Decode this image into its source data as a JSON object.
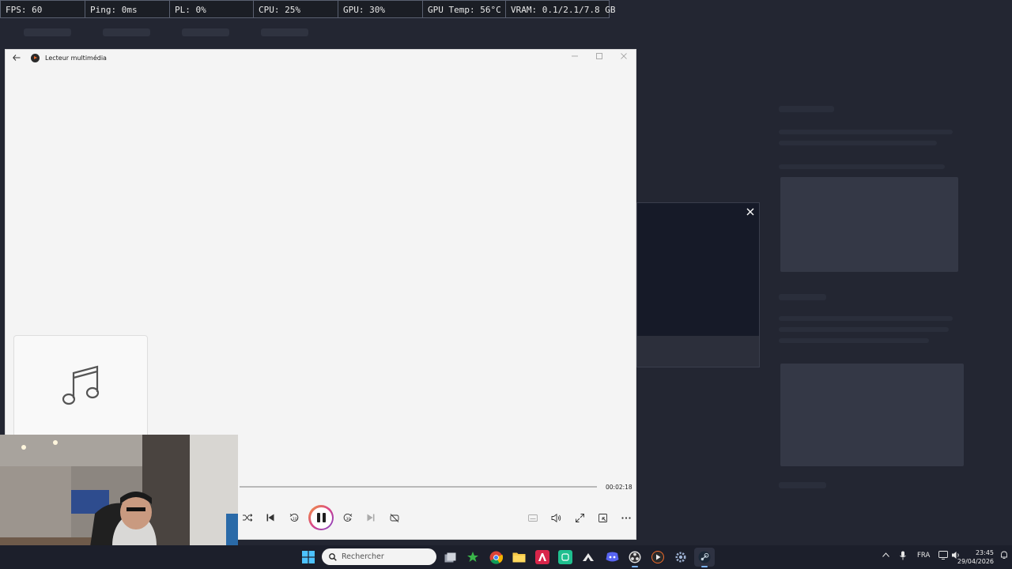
{
  "overlay": {
    "fps": "FPS: 60",
    "ping": "Ping: 0ms",
    "pl": "PL: 0%",
    "cpu": "CPU: 25%",
    "gpu": "GPU: 30%",
    "gpu_temp": "GPU Temp: 56°C",
    "vram": "VRAM: 0.1/2.1/7.8 GB"
  },
  "player": {
    "title": "Lecteur multimédia",
    "duration": "00:02:18",
    "progress_fraction": 0.0,
    "state": "playing",
    "skip_back_label": "10",
    "skip_forward_label": "30",
    "accent_gradient": [
      "#f29b3f",
      "#d8438a",
      "#7a3fc8"
    ],
    "icons": {
      "back": "arrow-left-icon",
      "app": "media-player-icon",
      "minimize": "minimize-icon",
      "maximize": "maximize-icon",
      "close": "close-icon",
      "album": "music-note-icon",
      "shuffle": "shuffle-icon",
      "previous": "previous-track-icon",
      "skip_back": "skip-back-10-icon",
      "pause": "pause-icon",
      "skip_forward": "skip-forward-30-icon",
      "next": "next-track-icon",
      "repeat": "repeat-off-icon",
      "captions": "captions-icon",
      "volume": "volume-icon",
      "fullscreen": "fullscreen-icon",
      "miniplayer": "mini-player-icon",
      "more": "more-options-icon"
    }
  },
  "dialog": {
    "close_icon": "close-icon"
  },
  "taskbar": {
    "search_placeholder": "Rechercher",
    "language": "FRA",
    "time": "23:45",
    "date": "29/04/2026",
    "icons": [
      "windows-start-icon",
      "search-icon",
      "task-view-icon",
      "app-green-icon",
      "chrome-icon",
      "file-explorer-icon",
      "adobe-icon",
      "green-app-icon",
      "alienware-icon",
      "discord-icon",
      "obs-icon",
      "media-player-icon",
      "settings-icon",
      "steam-icon"
    ]
  },
  "colors": {
    "desktop_bg": "#232632",
    "window_bg": "#f4f4f4",
    "taskbar_bg": "#1c1f2b"
  }
}
